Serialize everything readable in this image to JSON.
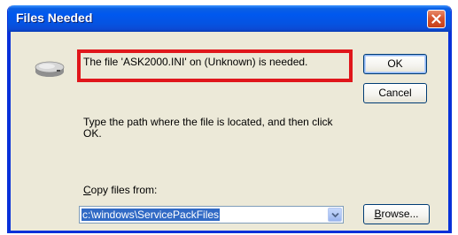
{
  "window": {
    "title": "Files Needed"
  },
  "message": {
    "text": "The file 'ASK2000.INI' on (Unknown) is needed."
  },
  "instruction": {
    "text": "Type the path where the file is located, and then click OK."
  },
  "copy_from": {
    "label_mnemonic": "C",
    "label_rest": "opy files from:",
    "value": "c:\\windows\\ServicePackFiles"
  },
  "buttons": {
    "ok": "OK",
    "cancel": "Cancel",
    "browse_mnemonic": "B",
    "browse_rest": "rowse..."
  },
  "colors": {
    "titlebar": "#0058ee",
    "highlight": "#e0161b",
    "selection": "#316ac5"
  },
  "icons": {
    "title_close": "close-icon",
    "drive": "drive-icon",
    "combo": "chevron-down-icon"
  }
}
